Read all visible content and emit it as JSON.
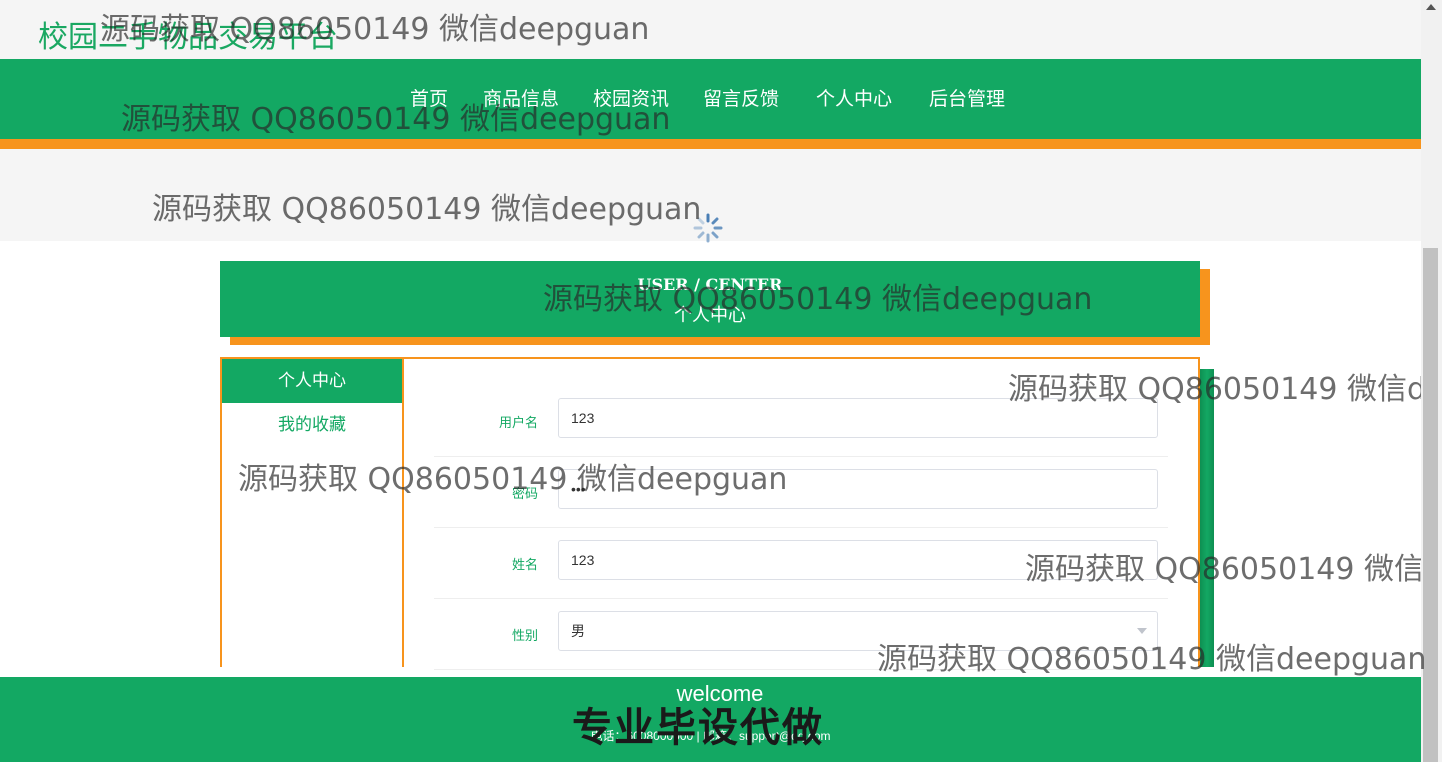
{
  "site": {
    "title": "校园二手物品交易平台"
  },
  "nav": {
    "items": [
      {
        "label": "首页"
      },
      {
        "label": "商品信息"
      },
      {
        "label": "校园资讯"
      },
      {
        "label": "留言反馈"
      },
      {
        "label": "个人中心"
      },
      {
        "label": "后台管理"
      }
    ]
  },
  "banner": {
    "english": "USER / CENTER",
    "chinese": "个人中心"
  },
  "sidebar": {
    "items": [
      {
        "label": "个人中心",
        "active": true
      },
      {
        "label": "我的收藏",
        "active": false
      }
    ]
  },
  "form": {
    "fields": [
      {
        "label": "用户名",
        "value": "123"
      },
      {
        "label": "密码",
        "value": "•••"
      },
      {
        "label": "姓名",
        "value": "123"
      },
      {
        "label": "性别",
        "value": "男"
      }
    ]
  },
  "footer": {
    "welcome": "welcome",
    "contact": "电话：6008000000 | 邮箱：support@qq.com",
    "promo": "专业毕设代做"
  },
  "watermark": {
    "text": "源码获取 QQ86050149 微信deepguan"
  },
  "colors": {
    "primary": "#13a863",
    "accent": "#f7941d"
  }
}
